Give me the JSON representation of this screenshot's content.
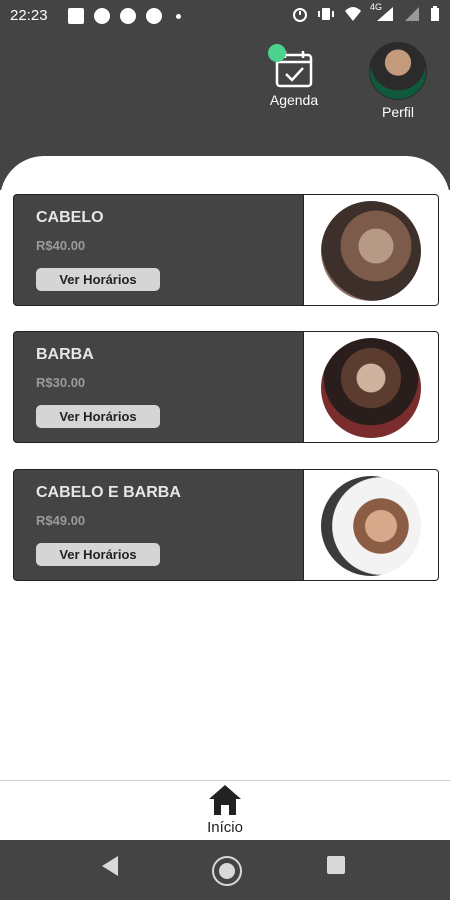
{
  "status_bar": {
    "time": "22:23",
    "network": "4G"
  },
  "header": {
    "agenda_label": "Agenda",
    "perfil_label": "Perfil"
  },
  "services": [
    {
      "name": "CABELO",
      "price": "R$40.00",
      "button_label": "Ver Horários",
      "image": "haircut-photo"
    },
    {
      "name": "BARBA",
      "price": "R$30.00",
      "button_label": "Ver Horários",
      "image": "beard-photo"
    },
    {
      "name": "CABELO E BARBA",
      "price": "R$49.00",
      "button_label": "Ver Horários",
      "image": "haircut-and-beard-photo"
    }
  ],
  "bottom_nav": {
    "home_label": "Início"
  },
  "colors": {
    "header_bg": "#444444",
    "badge_green": "#4bd38d",
    "card_bg": "#444444"
  }
}
